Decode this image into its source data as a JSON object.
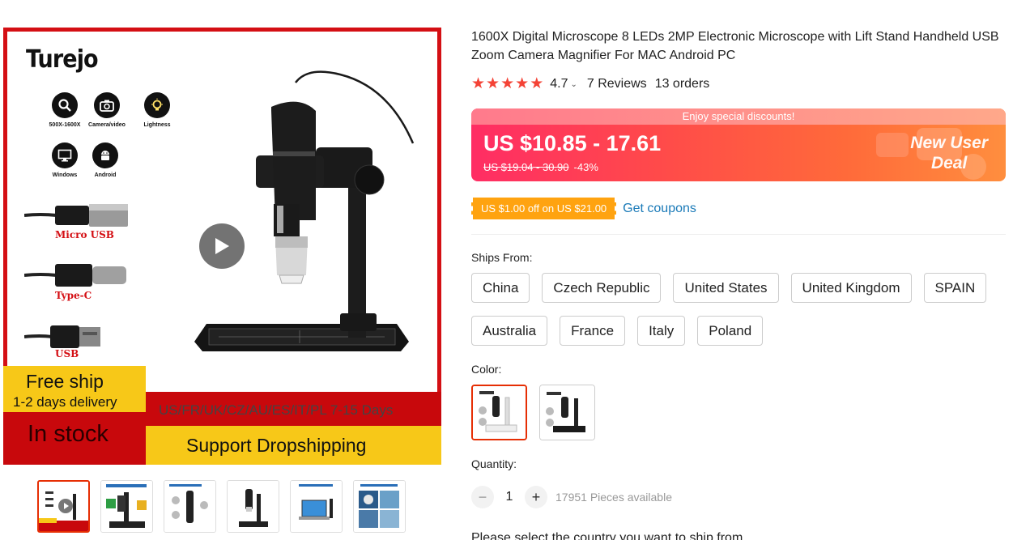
{
  "gallery": {
    "brand": "Turejo",
    "features": [
      {
        "label": "500X-1600X",
        "icon": "magnifier-icon"
      },
      {
        "label": "Camera/video",
        "icon": "camera-icon"
      },
      {
        "label": "Lightness",
        "icon": "bulb-icon"
      },
      {
        "label": "Windows",
        "icon": "monitor-icon"
      },
      {
        "label": "Android",
        "icon": "android-icon"
      }
    ],
    "cables": [
      "Micro USB",
      "Type-C",
      "USB"
    ],
    "free_ship": "Free ship",
    "delivery": "1-2 days delivery",
    "routes": "US/FR/UK/CZ/AU/ES/IT/PL 7-15 Days",
    "in_stock": "In stock",
    "dropshipping": "Support Dropshipping",
    "thumbnails": [
      "thumb-1",
      "thumb-2",
      "thumb-3",
      "thumb-4",
      "thumb-5",
      "thumb-6"
    ],
    "accent_red": "#d40f14",
    "accent_yellow": "#f7c818"
  },
  "product": {
    "title": "1600X Digital Microscope 8 LEDs 2MP Electronic Microscope with Lift Stand Handheld USB Zoom Camera Magnifier For MAC Android PC",
    "rating": "4.7",
    "stars": 5,
    "reviews": "7 Reviews",
    "orders": "13 orders"
  },
  "price": {
    "banner_top": "Enjoy special discounts!",
    "current": "US $10.85 - 17.61",
    "original": "US $19.04 - 30.90",
    "discount": "-43%",
    "promo_line1": "New User",
    "promo_line2": "Deal"
  },
  "coupon": {
    "tag": "US $1.00 off on US $21.00",
    "link": "Get coupons"
  },
  "ships_from": {
    "label": "Ships From:",
    "row1": [
      "China",
      "Czech Republic",
      "United States",
      "United Kingdom",
      "SPAIN"
    ],
    "row2": [
      "Australia",
      "France",
      "Italy",
      "Poland"
    ]
  },
  "color": {
    "label": "Color:",
    "options": [
      "white-base",
      "black-base"
    ]
  },
  "quantity": {
    "label": "Quantity:",
    "minus": "−",
    "plus": "+",
    "value": "1",
    "available": "17951 Pieces available"
  },
  "shipping_note": "Please select the country you want to ship from"
}
